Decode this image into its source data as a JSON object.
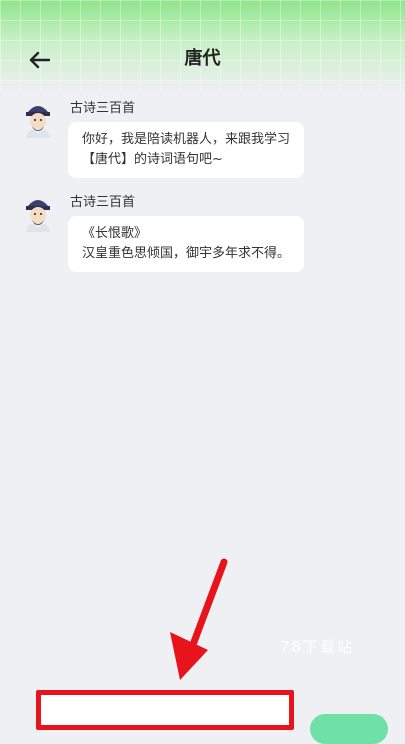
{
  "header": {
    "title": "唐代",
    "back_icon": "arrow-left-icon",
    "accent": "#8ee58a"
  },
  "messages": [
    {
      "sender": "古诗三百首",
      "avatar_icon": "scholar-avatar-icon",
      "lines": [
        "你好，我是陪读机器人，来跟我学习",
        "【唐代】的诗词语句吧~"
      ]
    },
    {
      "sender": "古诗三百首",
      "avatar_icon": "scholar-avatar-icon",
      "lines": [
        "《长恨歌》",
        "汉皇重色思倾国，御宇多年求不得。"
      ]
    }
  ],
  "watermark": "78下载站",
  "annotation": {
    "arrow_color": "#e8141c",
    "highlight_color": "#e8141c"
  },
  "input": {
    "placeholder": ""
  },
  "send_button": {
    "color": "#6fe0a8"
  }
}
